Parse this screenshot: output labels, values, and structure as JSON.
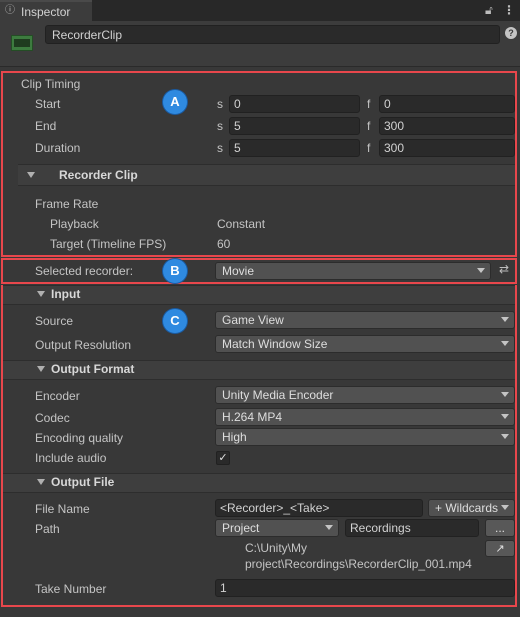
{
  "window": {
    "tab_label": "Inspector",
    "tab_icon": "info-icon",
    "lock_icon": "lock-icon",
    "menu_icon": "kebab-menu-icon"
  },
  "header": {
    "object_name": "RecorderClip",
    "object_icon": "recorder-clip-icon",
    "help_icon": "help-icon"
  },
  "clip_timing": {
    "title": "Clip Timing",
    "s_label": "s",
    "f_label": "f",
    "rows": [
      {
        "label": "Start",
        "seconds": "0",
        "frames": "0"
      },
      {
        "label": "End",
        "seconds": "5",
        "frames": "300"
      },
      {
        "label": "Duration",
        "seconds": "5",
        "frames": "300"
      }
    ]
  },
  "recorder_clip": {
    "title": "Recorder Clip",
    "frame_rate_label": "Frame Rate",
    "playback_label": "Playback",
    "playback_value": "Constant",
    "target_label": "Target (Timeline FPS)",
    "target_value": "60"
  },
  "recorder": {
    "label": "Selected recorder:",
    "value": "Movie"
  },
  "input": {
    "title": "Input",
    "source_label": "Source",
    "source_value": "Game View",
    "resolution_label": "Output Resolution",
    "resolution_value": "Match Window Size"
  },
  "output_format": {
    "title": "Output Format",
    "encoder_label": "Encoder",
    "encoder_value": "Unity Media Encoder",
    "codec_label": "Codec",
    "codec_value": "H.264 MP4",
    "quality_label": "Encoding quality",
    "quality_value": "High",
    "audio_label": "Include audio",
    "audio_checked": "✓"
  },
  "output_file": {
    "title": "Output File",
    "file_name_label": "File Name",
    "file_name_value": "<Recorder>_<Take>",
    "wildcards_label": "+ Wildcards",
    "path_label": "Path",
    "path_root": "Project",
    "path_value": "Recordings",
    "browse_label": "...",
    "full_path_line1": "C:\\Unity\\My",
    "full_path_line2": "project\\Recordings\\RecorderClip_001.mp4",
    "take_label": "Take Number",
    "take_value": "1"
  },
  "annotations": {
    "a": "A",
    "b": "B",
    "c": "C",
    "color": "#e8474c",
    "badge_color": "#2f8ae0"
  }
}
